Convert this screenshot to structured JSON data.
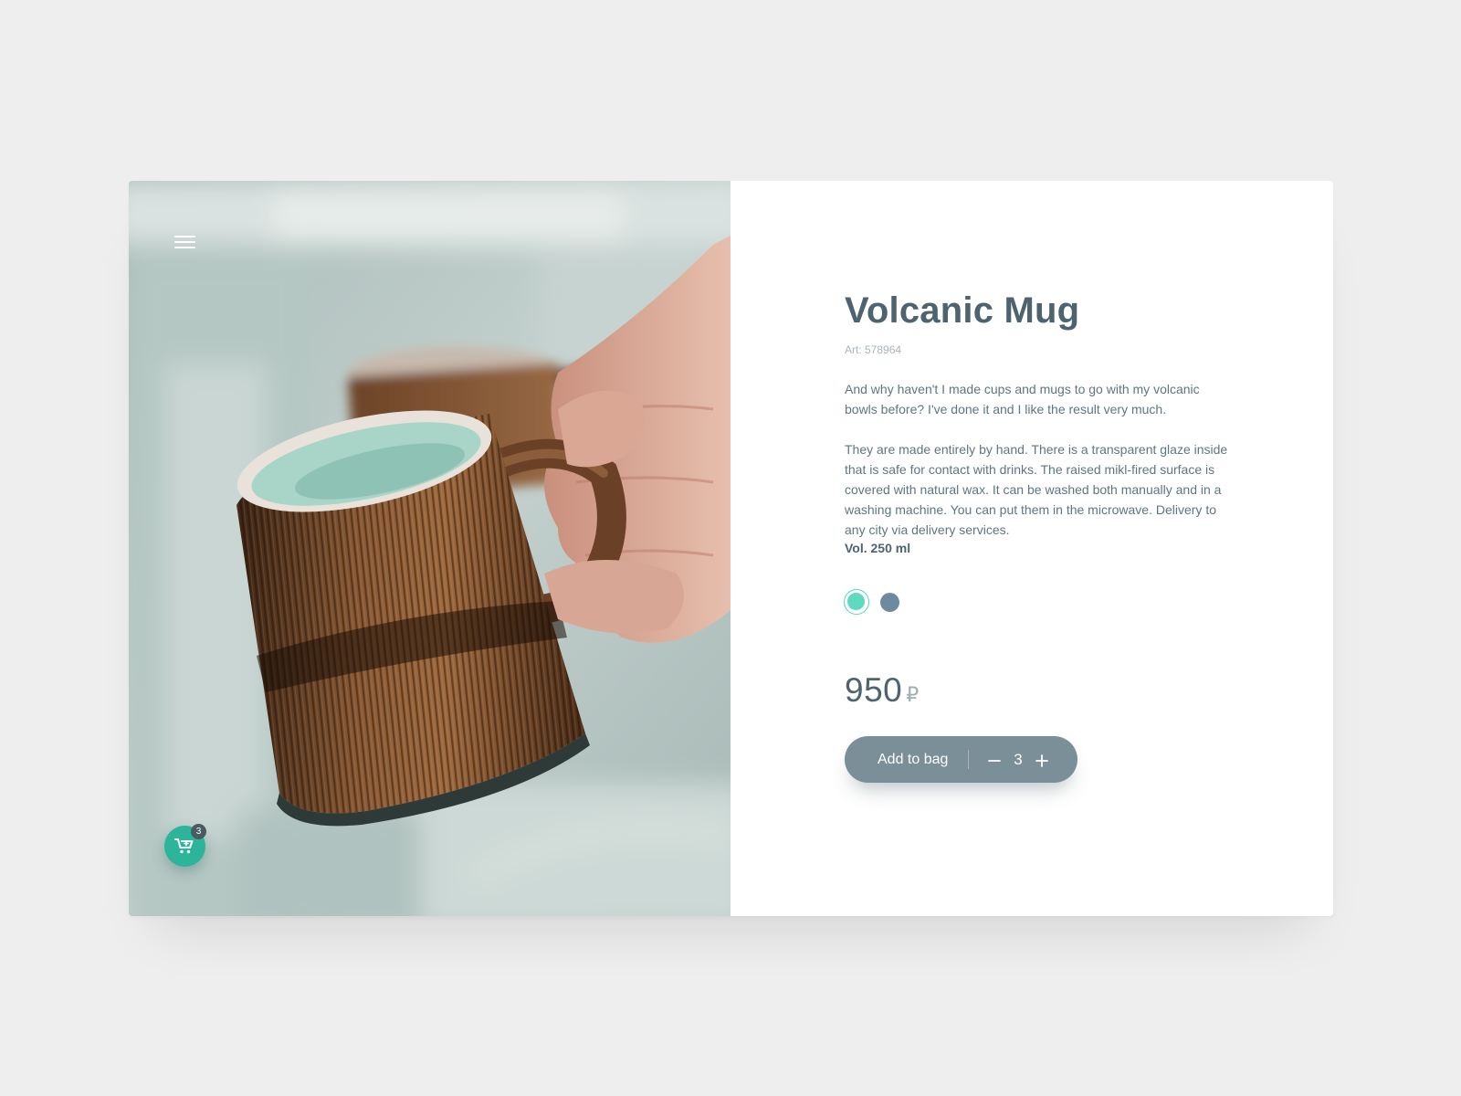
{
  "product": {
    "title": "Volcanic Mug",
    "article": "Art: 578964",
    "description": [
      "And why haven't I made cups and mugs to go with my volcanic bowls before? I've done it and I like the result very much.",
      "They are made entirely by hand. There is a transparent glaze inside that is safe for contact with drinks. The raised mikl-fired surface is covered with natural wax. It can be washed both manually and in a washing machine. You can put them in the microwave. Delivery to any city via delivery services."
    ],
    "volume": "Vol. 250 ml",
    "colors": [
      {
        "hex": "#5fd9bf",
        "selected": true
      },
      {
        "hex": "#6d8aa0",
        "selected": false
      }
    ],
    "price": "950",
    "currency": "₽"
  },
  "cart": {
    "add_label": "Add to bag",
    "minus_icon": "minus-icon",
    "plus_icon": "plus-icon",
    "quantity": "3",
    "badge_count": "3",
    "icon": "cart-icon"
  },
  "nav": {
    "menu_icon": "hamburger-menu-icon"
  },
  "photo": {
    "subject": "handmade-ceramic-mug-photo"
  },
  "theme": {
    "accent": "#2db59b",
    "text": "#4d6470",
    "button": "#7b8f98",
    "background": "#eeeeee"
  }
}
